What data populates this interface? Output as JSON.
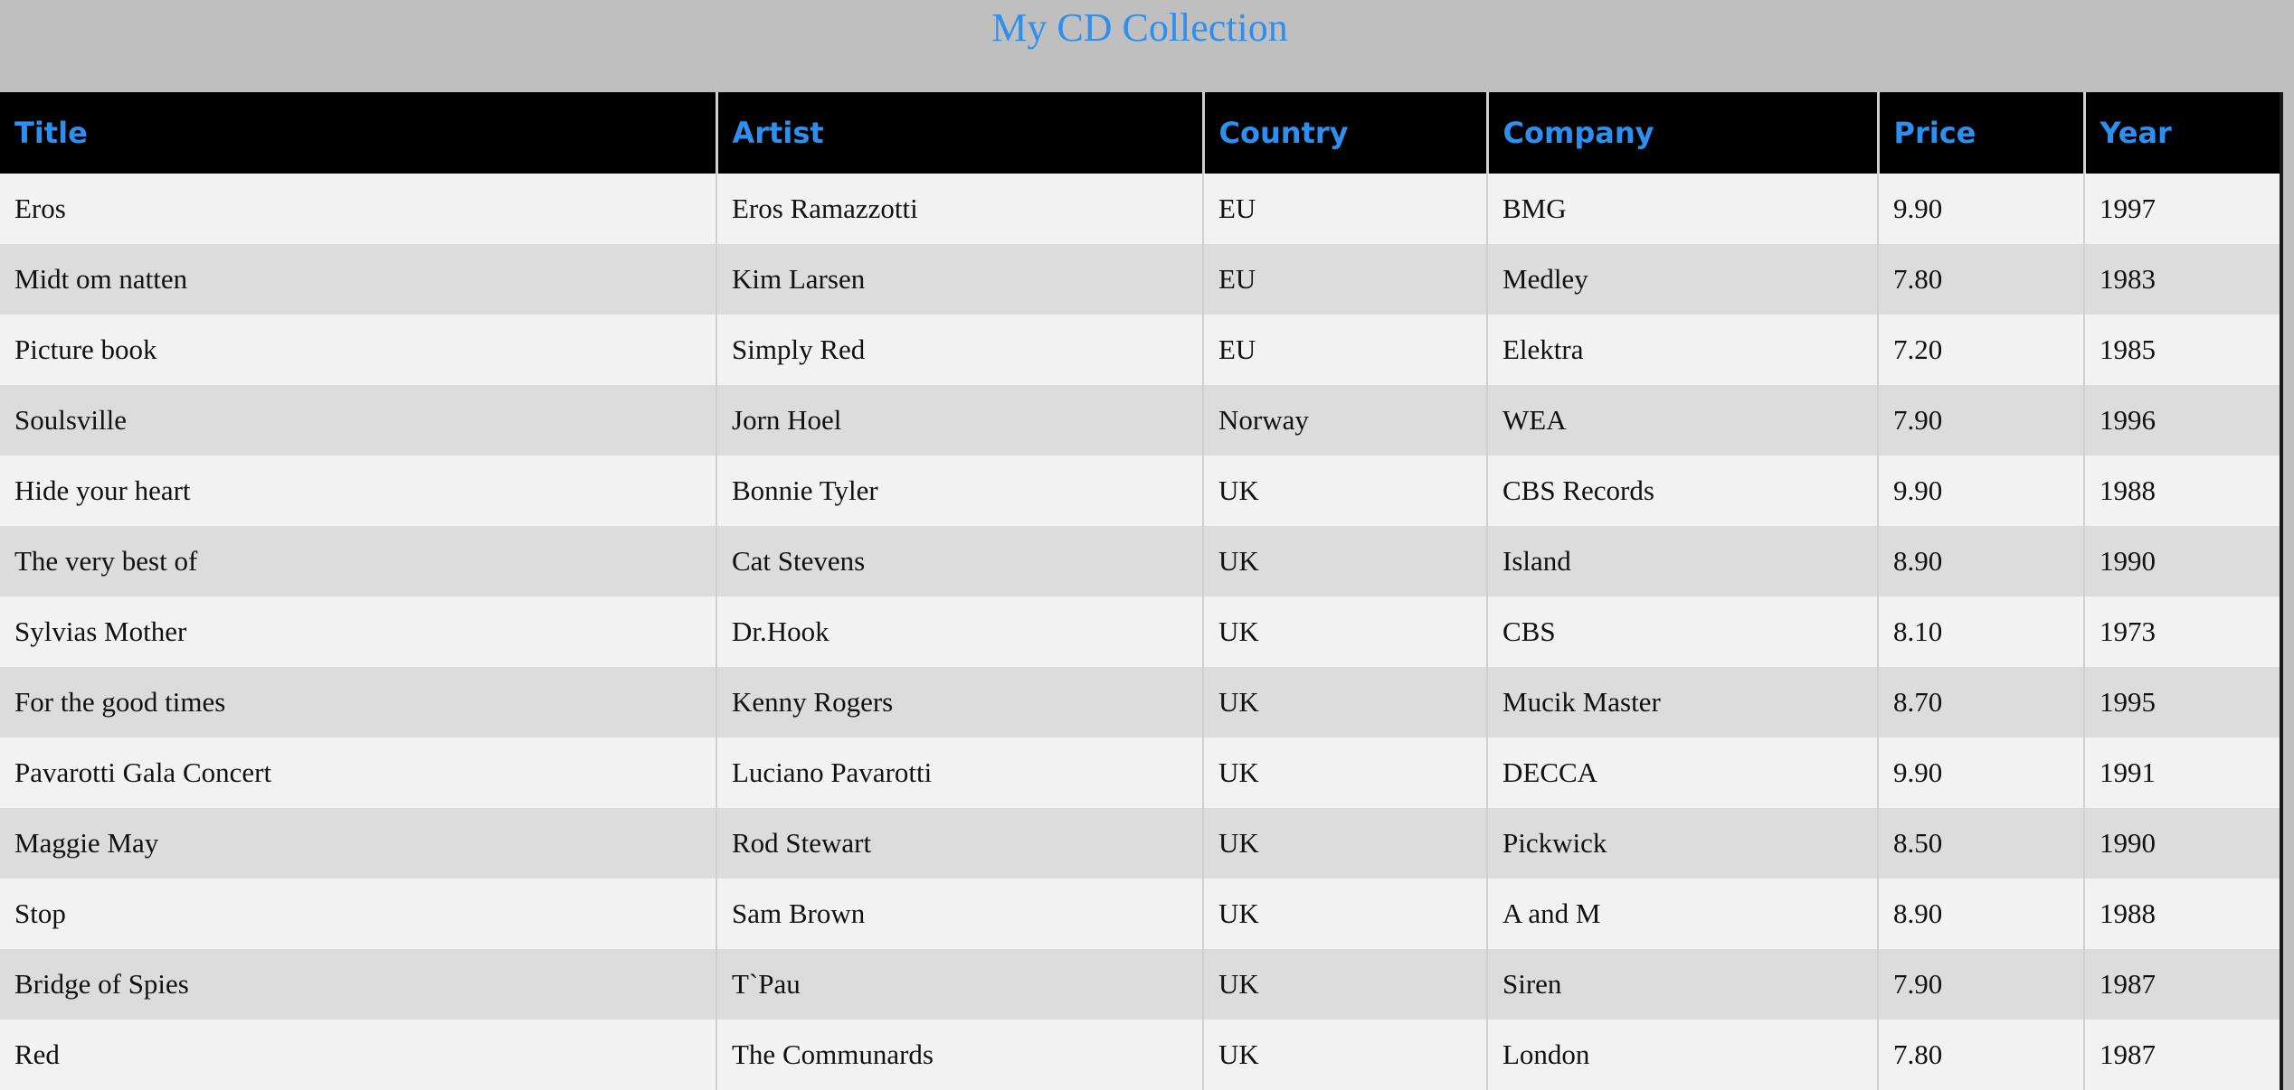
{
  "page": {
    "title": "My CD Collection",
    "accent_color": "#2d8ff0"
  },
  "table": {
    "headers": [
      "Title",
      "Artist",
      "Country",
      "Company",
      "Price",
      "Year"
    ],
    "rows": [
      [
        "Eros",
        "Eros Ramazzotti",
        "EU",
        "BMG",
        "9.90",
        "1997"
      ],
      [
        "Midt om natten",
        "Kim Larsen",
        "EU",
        "Medley",
        "7.80",
        "1983"
      ],
      [
        "Picture book",
        "Simply Red",
        "EU",
        "Elektra",
        "7.20",
        "1985"
      ],
      [
        "Soulsville",
        "Jorn Hoel",
        "Norway",
        "WEA",
        "7.90",
        "1996"
      ],
      [
        "Hide your heart",
        "Bonnie Tyler",
        "UK",
        "CBS Records",
        "9.90",
        "1988"
      ],
      [
        "The very best of",
        "Cat Stevens",
        "UK",
        "Island",
        "8.90",
        "1990"
      ],
      [
        "Sylvias Mother",
        "Dr.Hook",
        "UK",
        "CBS",
        "8.10",
        "1973"
      ],
      [
        "For the good times",
        "Kenny Rogers",
        "UK",
        "Mucik Master",
        "8.70",
        "1995"
      ],
      [
        "Pavarotti Gala Concert",
        "Luciano Pavarotti",
        "UK",
        "DECCA",
        "9.90",
        "1991"
      ],
      [
        "Maggie May",
        "Rod Stewart",
        "UK",
        "Pickwick",
        "8.50",
        "1990"
      ],
      [
        "Stop",
        "Sam Brown",
        "UK",
        "A and M",
        "8.90",
        "1988"
      ],
      [
        "Bridge of Spies",
        "T`Pau",
        "UK",
        "Siren",
        "7.90",
        "1987"
      ],
      [
        "Red",
        "The Communards",
        "UK",
        "London",
        "7.80",
        "1987"
      ]
    ]
  }
}
